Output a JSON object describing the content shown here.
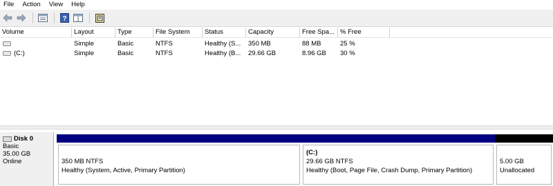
{
  "menu": [
    "File",
    "Action",
    "View",
    "Help"
  ],
  "toolbar": {
    "icons": [
      "back-arrow-icon",
      "forward-arrow-icon",
      "properties-icon",
      "help-icon",
      "show-hide-pane-icon",
      "settings-icon"
    ]
  },
  "volume_list": {
    "columns": [
      "Volume",
      "Layout",
      "Type",
      "File System",
      "Status",
      "Capacity",
      "Free Spa...",
      "% Free"
    ],
    "rows": [
      {
        "volume": "",
        "layout": "Simple",
        "type": "Basic",
        "fs": "NTFS",
        "status": "Healthy (S...",
        "capacity": "350 MB",
        "free": "88 MB",
        "pct": "25 %"
      },
      {
        "volume": "(C:)",
        "layout": "Simple",
        "type": "Basic",
        "fs": "NTFS",
        "status": "Healthy (B...",
        "capacity": "29.66 GB",
        "free": "8.96 GB",
        "pct": "30 %"
      }
    ]
  },
  "disk": {
    "name": "Disk 0",
    "type": "Basic",
    "size": "35.00 GB",
    "state": "Online",
    "partitions": [
      {
        "title": "",
        "size": "350 MB NTFS",
        "status": "Healthy (System, Active, Primary Partition)",
        "bar_color": "#000080"
      },
      {
        "title": "(C:)",
        "size": "29.66 GB NTFS",
        "status": "Healthy (Boot, Page File, Crash Dump, Primary Partition)",
        "bar_color": "#000080"
      },
      {
        "title": "",
        "size": "5.00 GB",
        "status": "Unallocated",
        "bar_color": "#000000"
      }
    ]
  }
}
